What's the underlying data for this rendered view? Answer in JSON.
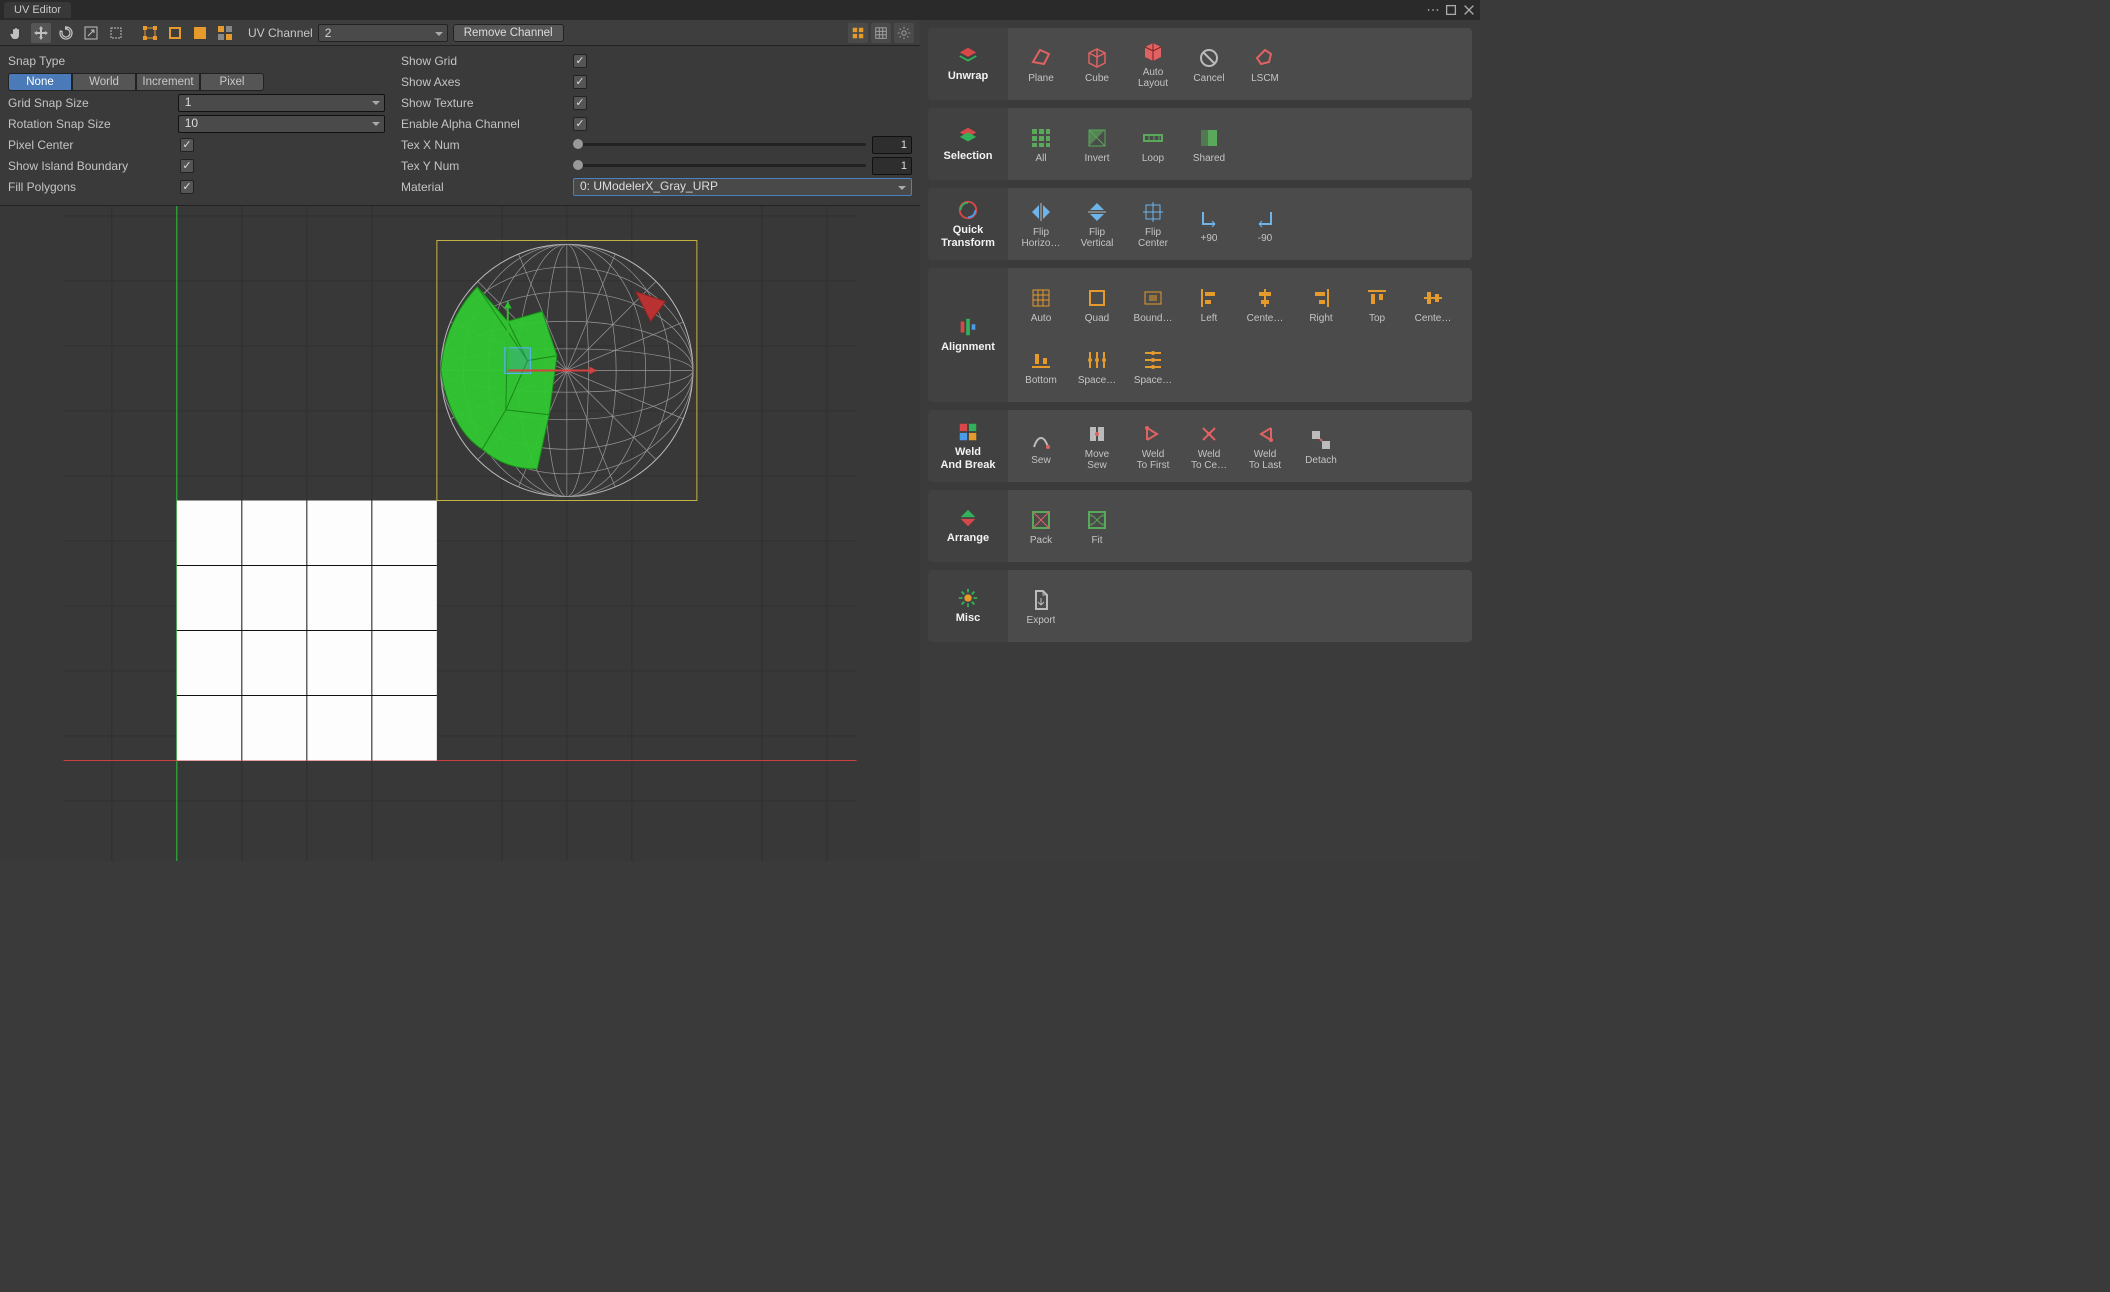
{
  "window": {
    "title": "UV Editor"
  },
  "toolbar": {
    "uvchannel_label": "UV Channel",
    "uvchannel_value": "2",
    "remove_btn": "Remove Channel"
  },
  "settings_left": {
    "snap_type_label": "Snap Type",
    "snap_options": [
      "None",
      "World",
      "Increment",
      "Pixel"
    ],
    "snap_selected": 0,
    "grid_snap_label": "Grid Snap Size",
    "grid_snap_value": "1",
    "rot_snap_label": "Rotation Snap Size",
    "rot_snap_value": "10",
    "pixel_center_label": "Pixel Center",
    "pixel_center": true,
    "island_boundary_label": "Show Island Boundary",
    "island_boundary": true,
    "fill_poly_label": "Fill Polygons",
    "fill_poly": true
  },
  "settings_right": {
    "show_grid_label": "Show Grid",
    "show_grid": true,
    "show_axes_label": "Show Axes",
    "show_axes": true,
    "show_tex_label": "Show Texture",
    "show_tex": true,
    "alpha_label": "Enable Alpha Channel",
    "alpha": true,
    "texx_label": "Tex X Num",
    "texx_value": "1",
    "texy_label": "Tex Y Num",
    "texy_value": "1",
    "material_label": "Material",
    "material_value": "0: UModelerX_Gray_URP"
  },
  "groups": {
    "unwrap": {
      "title": "Unwrap",
      "tools": [
        {
          "label": "Plane"
        },
        {
          "label": "Cube"
        },
        {
          "label": "Auto",
          "label2": "Layout"
        },
        {
          "label": "Cancel"
        },
        {
          "label": "LSCM"
        }
      ]
    },
    "selection": {
      "title": "Selection",
      "tools": [
        {
          "label": "All"
        },
        {
          "label": "Invert"
        },
        {
          "label": "Loop"
        },
        {
          "label": "Shared"
        }
      ]
    },
    "qtransform": {
      "title": "Quick",
      "title2": "Transform",
      "tools": [
        {
          "label": "Flip",
          "label2": "Horizo…"
        },
        {
          "label": "Flip",
          "label2": "Vertical"
        },
        {
          "label": "Flip",
          "label2": "Center"
        },
        {
          "label": "+90"
        },
        {
          "label": "-90"
        }
      ]
    },
    "alignment": {
      "title": "Alignment",
      "tools": [
        {
          "label": "Auto"
        },
        {
          "label": "Quad"
        },
        {
          "label": "Bound…"
        },
        {
          "label": "Left"
        },
        {
          "label": "Cente…"
        },
        {
          "label": "Right"
        },
        {
          "label": "Top"
        },
        {
          "label": "Cente…"
        },
        {
          "label": "Bottom"
        },
        {
          "label": "Space…"
        },
        {
          "label": "Space…"
        }
      ]
    },
    "weld": {
      "title": "Weld",
      "title2": "And Break",
      "tools": [
        {
          "label": "Sew"
        },
        {
          "label": "Move",
          "label2": "Sew"
        },
        {
          "label": "Weld",
          "label2": "To First"
        },
        {
          "label": "Weld",
          "label2": "To Ce…"
        },
        {
          "label": "Weld",
          "label2": "To Last"
        },
        {
          "label": "Detach"
        }
      ]
    },
    "arrange": {
      "title": "Arrange",
      "tools": [
        {
          "label": "Pack"
        },
        {
          "label": "Fit"
        }
      ]
    },
    "misc": {
      "title": "Misc",
      "tools": [
        {
          "label": "Export"
        }
      ]
    }
  }
}
